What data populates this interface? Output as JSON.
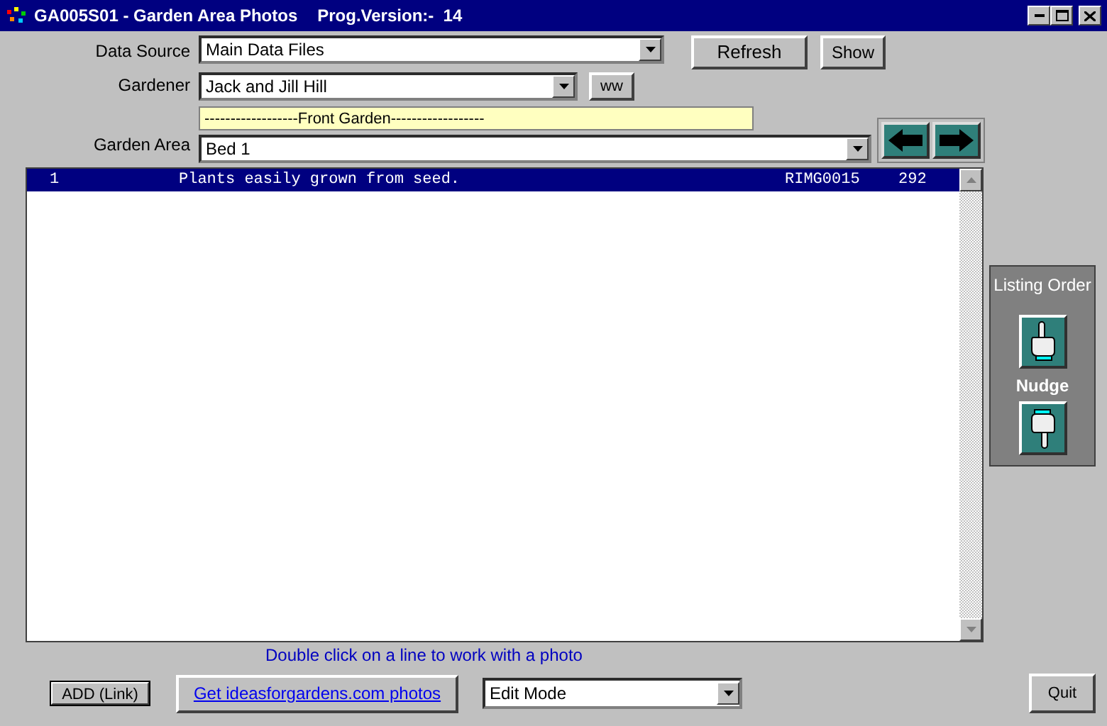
{
  "window": {
    "title": "GA005S01 - Garden Area Photos",
    "version": "Prog.Version:-  14"
  },
  "data_source": {
    "label": "Data Source",
    "value": "Main Data Files"
  },
  "top_buttons": [
    "Refresh",
    "Show"
  ],
  "gardener": {
    "label": "Gardener",
    "value": "Jack and Jill Hill",
    "button": "ww"
  },
  "section_banner": "------------------Front Garden------------------",
  "garden_area": {
    "label": "Garden Area",
    "value": "Bed 1"
  },
  "photos": [
    {
      "number": "1",
      "description": "Plants easily grown from seed.",
      "photo_id": "RIMG0015",
      "size": "292",
      "selected": true
    }
  ],
  "listing_order": {
    "title": "Listing Order",
    "nudge_label": "Nudge"
  },
  "hint": "Double click on a line to work with a photo",
  "add_button": "ADD (Link)",
  "link_button": "Get ideasforgardens.com photos",
  "mode": {
    "value": "Edit Mode"
  },
  "quit_button": "Quit"
}
